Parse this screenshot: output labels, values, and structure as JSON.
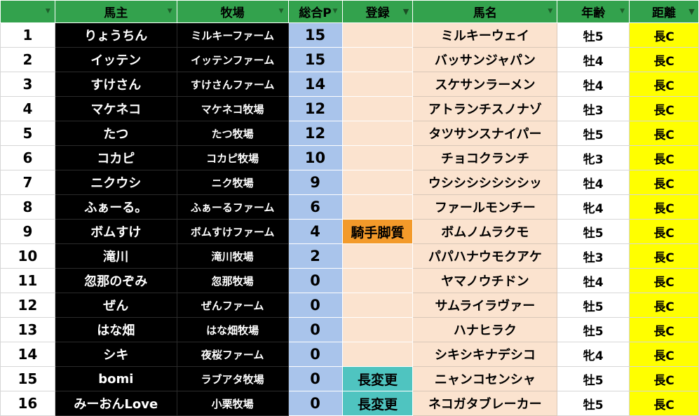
{
  "headers": {
    "index": "",
    "owner": "馬主",
    "farm": "牧場",
    "points": "総合P",
    "registration": "登録",
    "horse": "馬名",
    "age": "年齢",
    "distance": "距離"
  },
  "filter_icons": {
    "inactive": "filter-dropdown-icon",
    "active": "filter-applied-icon"
  },
  "colors": {
    "header_green": "#33a24d",
    "points_blue": "#a9c4eb",
    "reg_peach": "#fbe3cf",
    "reg_orange": "#f39a2a",
    "reg_teal": "#4fc4c0",
    "distance_yellow": "#ffff00"
  },
  "rows": [
    {
      "idx": "1",
      "owner": "りょうちん",
      "farm": "ミルキーファーム",
      "points": "15",
      "reg": "",
      "reg_style": "",
      "horse": "ミルキーウェイ",
      "age": "牡5",
      "dist": "長C"
    },
    {
      "idx": "2",
      "owner": "イッテン",
      "farm": "イッテンファーム",
      "points": "15",
      "reg": "",
      "reg_style": "",
      "horse": "バッサンジャパン",
      "age": "牡4",
      "dist": "長C"
    },
    {
      "idx": "3",
      "owner": "すけさん",
      "farm": "すけさんファーム",
      "points": "14",
      "reg": "",
      "reg_style": "",
      "horse": "スケサンラーメン",
      "age": "牡4",
      "dist": "長C"
    },
    {
      "idx": "4",
      "owner": "マケネコ",
      "farm": "マケネコ牧場",
      "points": "12",
      "reg": "",
      "reg_style": "",
      "horse": "アトランチスノナゾ",
      "age": "牡3",
      "dist": "長C"
    },
    {
      "idx": "5",
      "owner": "たつ",
      "farm": "たつ牧場",
      "points": "12",
      "reg": "",
      "reg_style": "",
      "horse": "タツサンスナイパー",
      "age": "牡5",
      "dist": "長C"
    },
    {
      "idx": "6",
      "owner": "コカピ",
      "farm": "コカピ牧場",
      "points": "10",
      "reg": "",
      "reg_style": "",
      "horse": "チョコクランチ",
      "age": "牝3",
      "dist": "長C"
    },
    {
      "idx": "7",
      "owner": "ニクウシ",
      "farm": "ニク牧場",
      "points": "9",
      "reg": "",
      "reg_style": "",
      "horse": "ウシシシシシシシッ",
      "age": "牡4",
      "dist": "長C"
    },
    {
      "idx": "8",
      "owner": "ふぁーる。",
      "farm": "ふぁーるファーム",
      "points": "6",
      "reg": "",
      "reg_style": "",
      "horse": "ファールモンチー",
      "age": "牝4",
      "dist": "長C"
    },
    {
      "idx": "9",
      "owner": "ボムすけ",
      "farm": "ボムすけファーム",
      "points": "4",
      "reg": "騎手脚質",
      "reg_style": "orange",
      "horse": "ボムノムラクモ",
      "age": "牡5",
      "dist": "長C"
    },
    {
      "idx": "10",
      "owner": "滝川",
      "farm": "滝川牧場",
      "points": "2",
      "reg": "",
      "reg_style": "",
      "horse": "パパハナウモクアケ",
      "age": "牡3",
      "dist": "長C"
    },
    {
      "idx": "11",
      "owner": "忽那のぞみ",
      "farm": "忽那牧場",
      "points": "0",
      "reg": "",
      "reg_style": "",
      "horse": "ヤマノウチドン",
      "age": "牡4",
      "dist": "長C"
    },
    {
      "idx": "12",
      "owner": "ぜん",
      "farm": "ぜんファーム",
      "points": "0",
      "reg": "",
      "reg_style": "",
      "horse": "サムライラヴァー",
      "age": "牡5",
      "dist": "長C"
    },
    {
      "idx": "13",
      "owner": "はな畑",
      "farm": "はな畑牧場",
      "points": "0",
      "reg": "",
      "reg_style": "",
      "horse": "ハナヒラク",
      "age": "牡5",
      "dist": "長C"
    },
    {
      "idx": "14",
      "owner": "シキ",
      "farm": "夜桜ファーム",
      "points": "0",
      "reg": "",
      "reg_style": "",
      "horse": "シキシキナデシコ",
      "age": "牝4",
      "dist": "長C"
    },
    {
      "idx": "15",
      "owner": "bomi",
      "farm": "ラブアタ牧場",
      "points": "0",
      "reg": "長変更",
      "reg_style": "teal",
      "horse": "ニャンコセンシャ",
      "age": "牡5",
      "dist": "長C"
    },
    {
      "idx": "16",
      "owner": "みーおんLove",
      "farm": "小栗牧場",
      "points": "0",
      "reg": "長変更",
      "reg_style": "teal",
      "horse": "ネコガタブレーカー",
      "age": "牡5",
      "dist": "長C"
    }
  ]
}
